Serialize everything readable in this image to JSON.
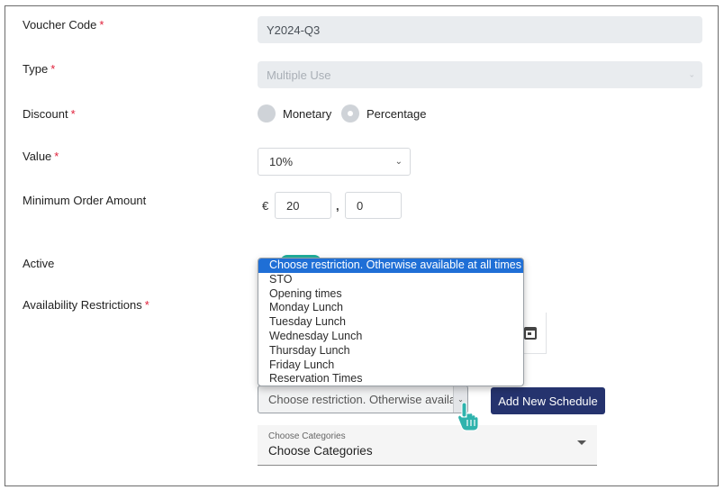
{
  "form": {
    "voucher_code": {
      "label": "Voucher Code",
      "value": "Y2024-Q3"
    },
    "type": {
      "label": "Type",
      "value": "Multiple Use"
    },
    "discount": {
      "label": "Discount",
      "option_monetary": "Monetary",
      "option_percentage": "Percentage",
      "selected": "Percentage"
    },
    "value": {
      "label": "Value",
      "selected": "10%"
    },
    "min_order": {
      "label": "Minimum Order Amount",
      "currency": "€",
      "integer": "20",
      "separator": ",",
      "decimal": "0"
    },
    "active": {
      "label": "Active"
    },
    "availability": {
      "label": "Availability Restrictions",
      "dropdown_options": [
        "Choose restriction. Otherwise available at all times",
        "STO",
        "Opening times",
        "Monday Lunch",
        "Tuesday Lunch",
        "Wednesday Lunch",
        "Thursday Lunch",
        "Friday Lunch",
        "Reservation Times"
      ],
      "select_text": "Choose restriction. Otherwise available at all times",
      "add_schedule_button": "Add New Schedule"
    },
    "categories": {
      "floating_label": "Choose Categories",
      "value": "Choose Categories"
    },
    "required_marker": "*"
  },
  "colors": {
    "accent": "#25336e",
    "highlight": "#1f6fd6",
    "toggle": "#1fae9c",
    "required": "#e0203a"
  }
}
